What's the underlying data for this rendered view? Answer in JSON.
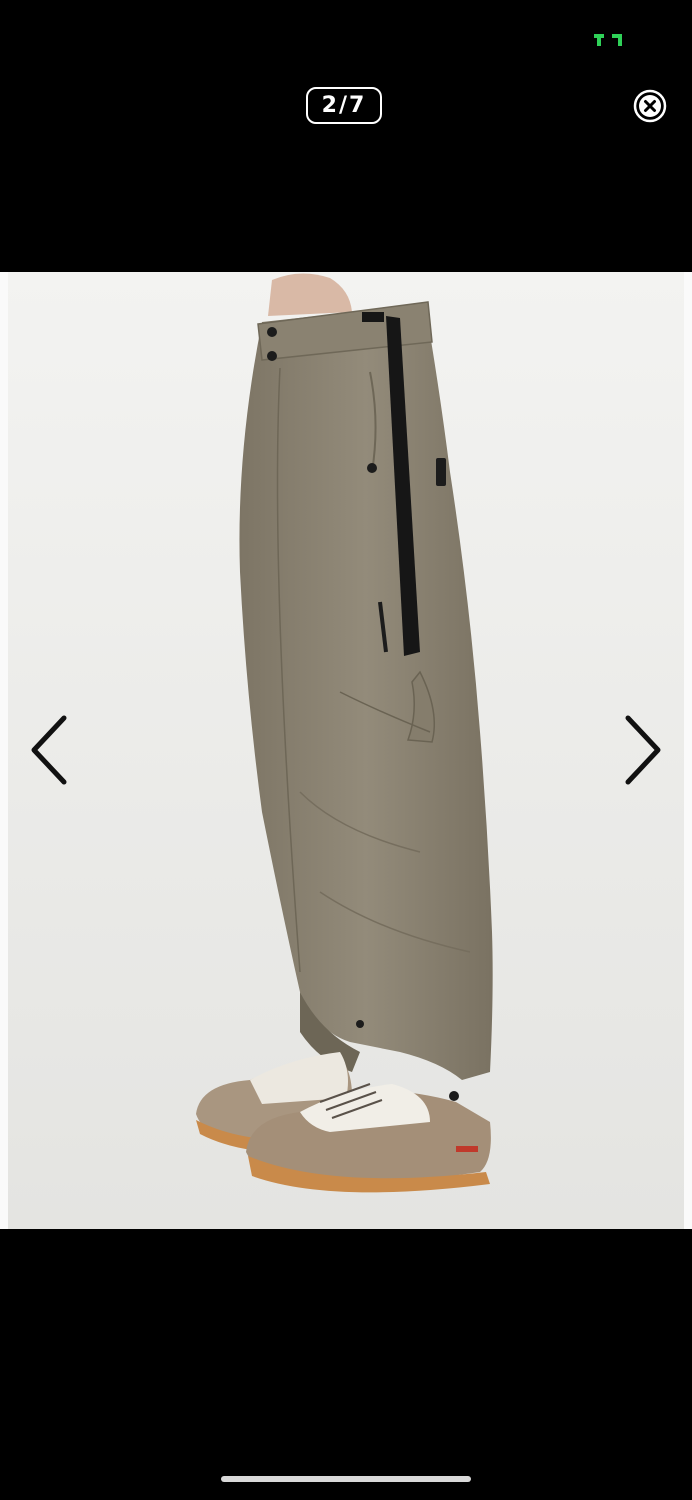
{
  "viewer": {
    "counter": "2/7",
    "current_index": 2,
    "total_count": 7
  },
  "icons": {
    "status": "battery-status-icon",
    "close": "close-circle-icon",
    "prev": "chevron-left-icon",
    "next": "chevron-right-icon"
  },
  "colors": {
    "background": "#000000",
    "photo_backdrop": "#ececea",
    "status_accent": "#2fd158",
    "pants": "#8a8271",
    "sole": "#c98a4a"
  }
}
